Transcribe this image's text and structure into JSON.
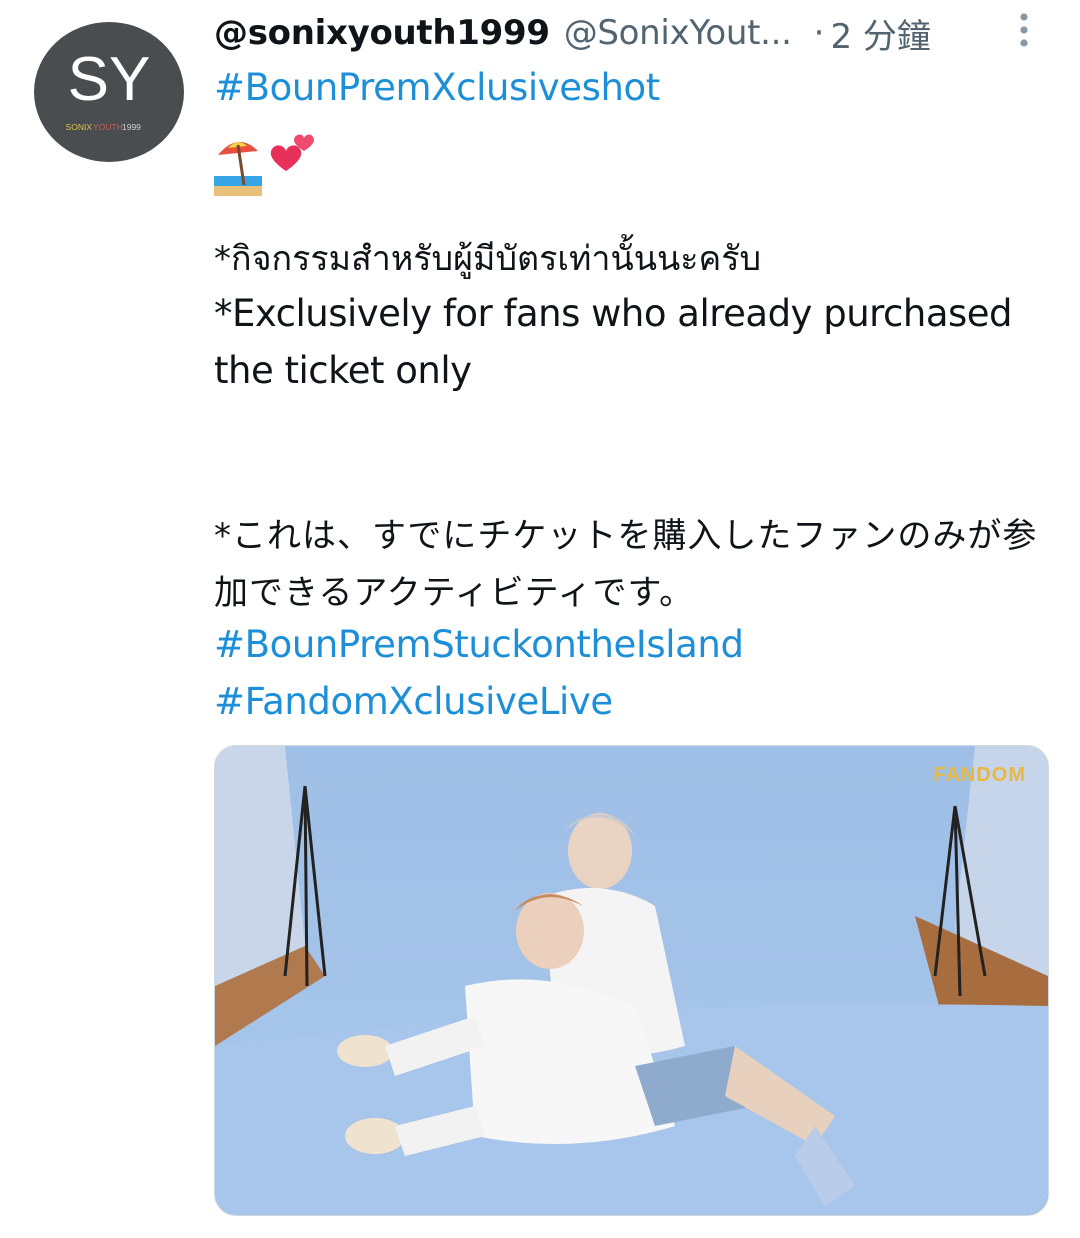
{
  "tweet": {
    "avatar": {
      "monogram": "SY",
      "caption_left": "SONIX",
      "caption_mid": "YOUTH",
      "caption_right": "1999"
    },
    "display_name": "@sonixyouth1999",
    "handle": "@SonixYout...",
    "separator": "·",
    "time": "2 分鐘",
    "hashtag_top": "#BounPremXclusiveshot",
    "emojis": [
      "beach-umbrella",
      "two-hearts"
    ],
    "thai_line": "*กิจกรรมสำหรับผู้มีบัตรเท่านั้นนะครับ",
    "english_note": "*Exclusively for fans who already purchased the ticket only",
    "japanese_note": "*これは、すでにチケットを購入したファンのみが参加できるアクティビティです。",
    "hashtags_bottom": [
      "#BounPremStuckontheIsland",
      "#FandomXclusiveLive"
    ],
    "media_watermark": "FANDOM"
  },
  "colors": {
    "link": "#1d8fd8",
    "secondary_text": "#536471",
    "avatar_bg": "#4a4d50"
  }
}
